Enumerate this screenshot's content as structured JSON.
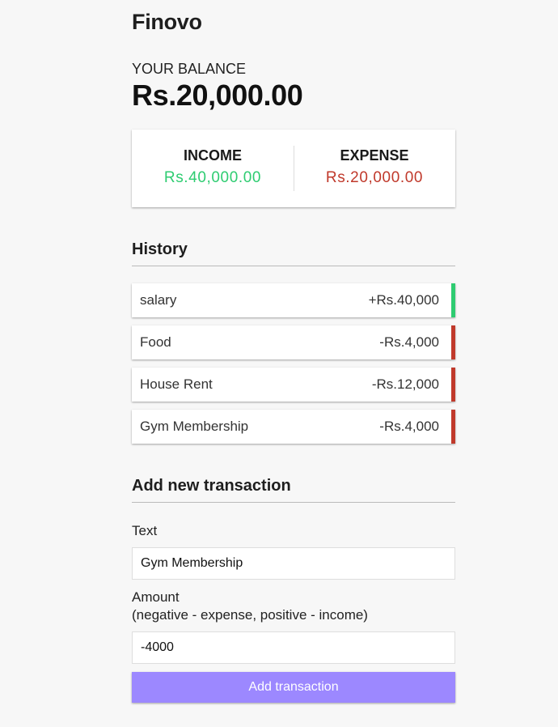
{
  "app": {
    "title": "Finovo"
  },
  "balance": {
    "label": "YOUR BALANCE",
    "value": "Rs.20,000.00"
  },
  "summary": {
    "income_label": "INCOME",
    "income_value": "Rs.40,000.00",
    "expense_label": "EXPENSE",
    "expense_value": "Rs.20,000.00",
    "income_color": "#2ecc71",
    "expense_color": "#c0392b"
  },
  "history": {
    "title": "History",
    "items": [
      {
        "text": "salary",
        "amount": "+Rs.40,000",
        "type": "plus"
      },
      {
        "text": "Food",
        "amount": "-Rs.4,000",
        "type": "minus"
      },
      {
        "text": "House Rent",
        "amount": "-Rs.12,000",
        "type": "minus"
      },
      {
        "text": "Gym Membership",
        "amount": "-Rs.4,000",
        "type": "minus"
      }
    ]
  },
  "form": {
    "title": "Add new transaction",
    "text_label": "Text",
    "text_value": "Gym Membership",
    "amount_label": "Amount",
    "amount_hint": "(negative - expense, positive - income)",
    "amount_value": "-4000",
    "submit_label": "Add transaction",
    "button_color": "#9c88ff"
  }
}
